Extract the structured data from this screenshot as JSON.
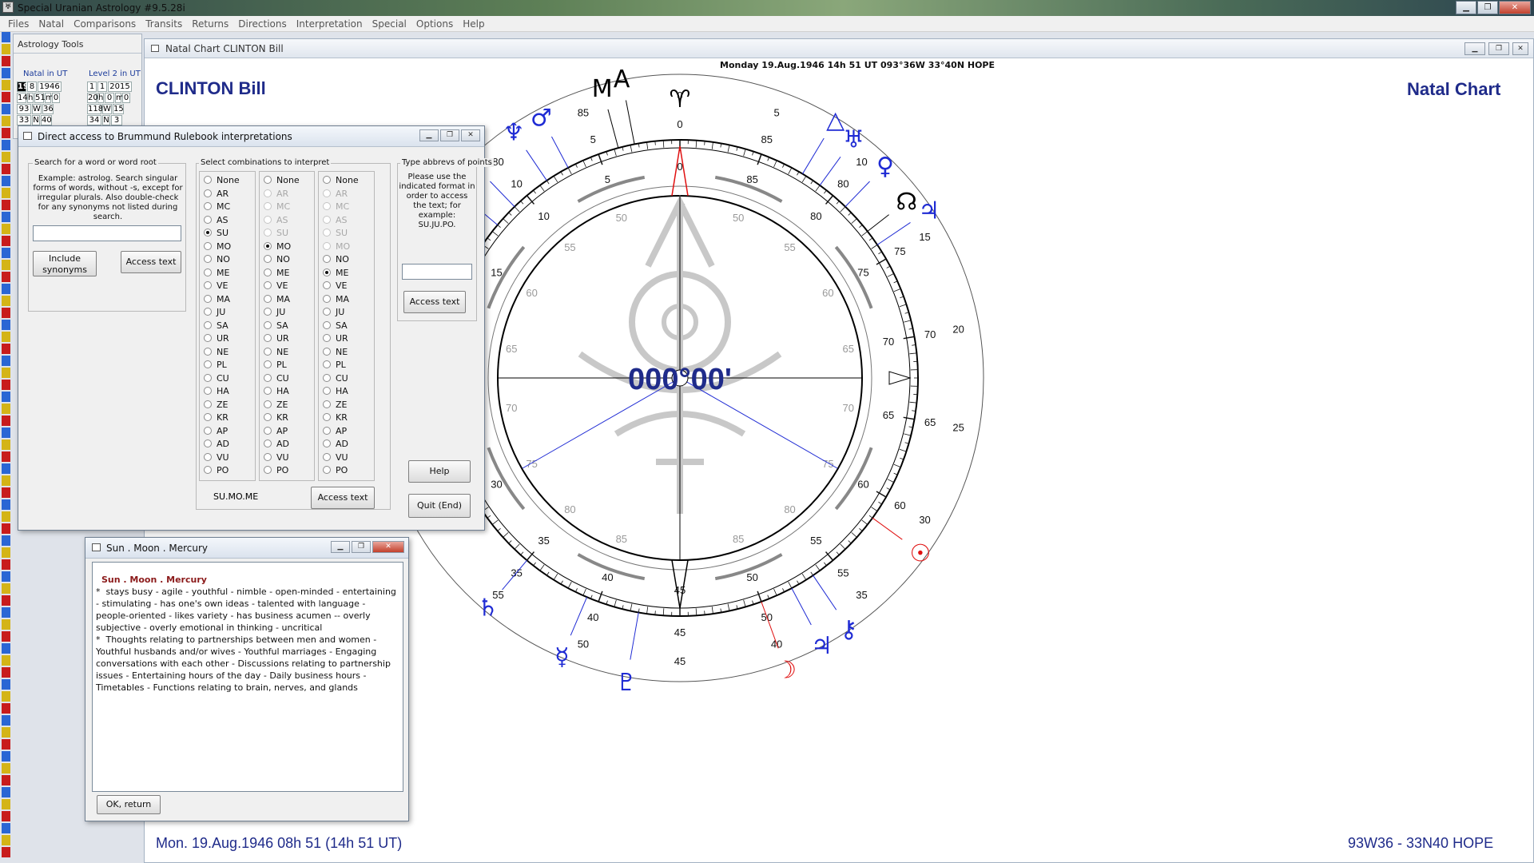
{
  "app": {
    "title": "Special Uranian Astrology #9.5.28i",
    "menu": [
      "Files",
      "Natal",
      "Comparisons",
      "Transits",
      "Returns",
      "Directions",
      "Interpretation",
      "Special",
      "Options",
      "Help"
    ]
  },
  "tools": {
    "title": "Astrology Tools",
    "natal_label": "Natal in UT",
    "level2_label": "Level 2 in UT",
    "natal_rows": [
      [
        "19",
        "8",
        "1946"
      ],
      [
        "14",
        "h",
        "51",
        "m",
        "0"
      ],
      [
        "93",
        "W",
        "36"
      ],
      [
        "33",
        "N",
        "40"
      ]
    ],
    "level2_rows": [
      [
        "1",
        "1",
        "2015"
      ],
      [
        "20",
        "h",
        "0",
        "m",
        "0"
      ],
      [
        "118",
        "W",
        "15"
      ],
      [
        "34",
        "N",
        "3"
      ]
    ]
  },
  "dialog": {
    "title": "Direct access to Brummund Rulebook interpretations",
    "search_group": "Search for a word or word root",
    "search_help": "Example: astrolog. Search singular forms of words, without -s, except for irregular plurals. Also double-check for any synonyms not listed during search.",
    "include_synonyms": "Include synonyms",
    "access_text": "Access text",
    "combo_group": "Select combinations to interpret",
    "abbrev_group": "Type abbrevs of points",
    "abbrev_help": "Please use the indicated format in order to access the text; for example: SU.JU.PO.",
    "selection_text": "SU.MO.ME",
    "help_button": "Help",
    "quit_button": "Quit (End)",
    "points": [
      "None",
      "AR",
      "MC",
      "AS",
      "SU",
      "MO",
      "NO",
      "ME",
      "VE",
      "MA",
      "JU",
      "SA",
      "UR",
      "NE",
      "PL",
      "CU",
      "HA",
      "ZE",
      "KR",
      "AP",
      "AD",
      "VU",
      "PO"
    ],
    "col1_selected": "SU",
    "col2_selected": "MO",
    "col3_selected": "ME"
  },
  "interp": {
    "title": "Sun . Moon . Mercury",
    "heading": "Sun . Moon . Mercury",
    "body": "*  stays busy - agile - youthful - nimble - open-minded - entertaining - stimulating - has one's own ideas - talented with language - people-oriented - likes variety - has business acumen -- overly subjective - overly emotional in thinking - uncritical\n*  Thoughts relating to partnerships between men and women - Youthful husbands and/or wives - Youthful marriages - Engaging conversations with each other - Discussions relating to partnership issues - Entertaining hours of the day - Daily business hours - Timetables - Functions relating to brain, nerves, and glands",
    "ok_button": "OK, return"
  },
  "chart": {
    "window_title": "Natal Chart  CLINTON Bill",
    "header_info": "Monday 19.Aug.1946 14h 51 UT 093°36W 33°40N  HOPE",
    "name": "CLINTON Bill",
    "label": "Natal Chart",
    "center_value": "000°00'",
    "footer_left": "Mon. 19.Aug.1946 08h 51 (14h 51 UT)",
    "footer_right": "93W36 - 33N40  HOPE",
    "outer_labels": [
      "0",
      "5",
      "10",
      "15",
      "20",
      "25",
      "30",
      "35",
      "40",
      "45",
      "50",
      "55",
      "60",
      "65",
      "70",
      "75",
      "80",
      "85"
    ],
    "colors": {
      "chart_blue": "#1f2bd4",
      "chart_red": "#e01010",
      "chart_black": "#000000",
      "text_navy": "#1f2b8a"
    }
  },
  "stripe_colors": [
    "#2a66d4",
    "#d4b417",
    "#c81c1c"
  ]
}
